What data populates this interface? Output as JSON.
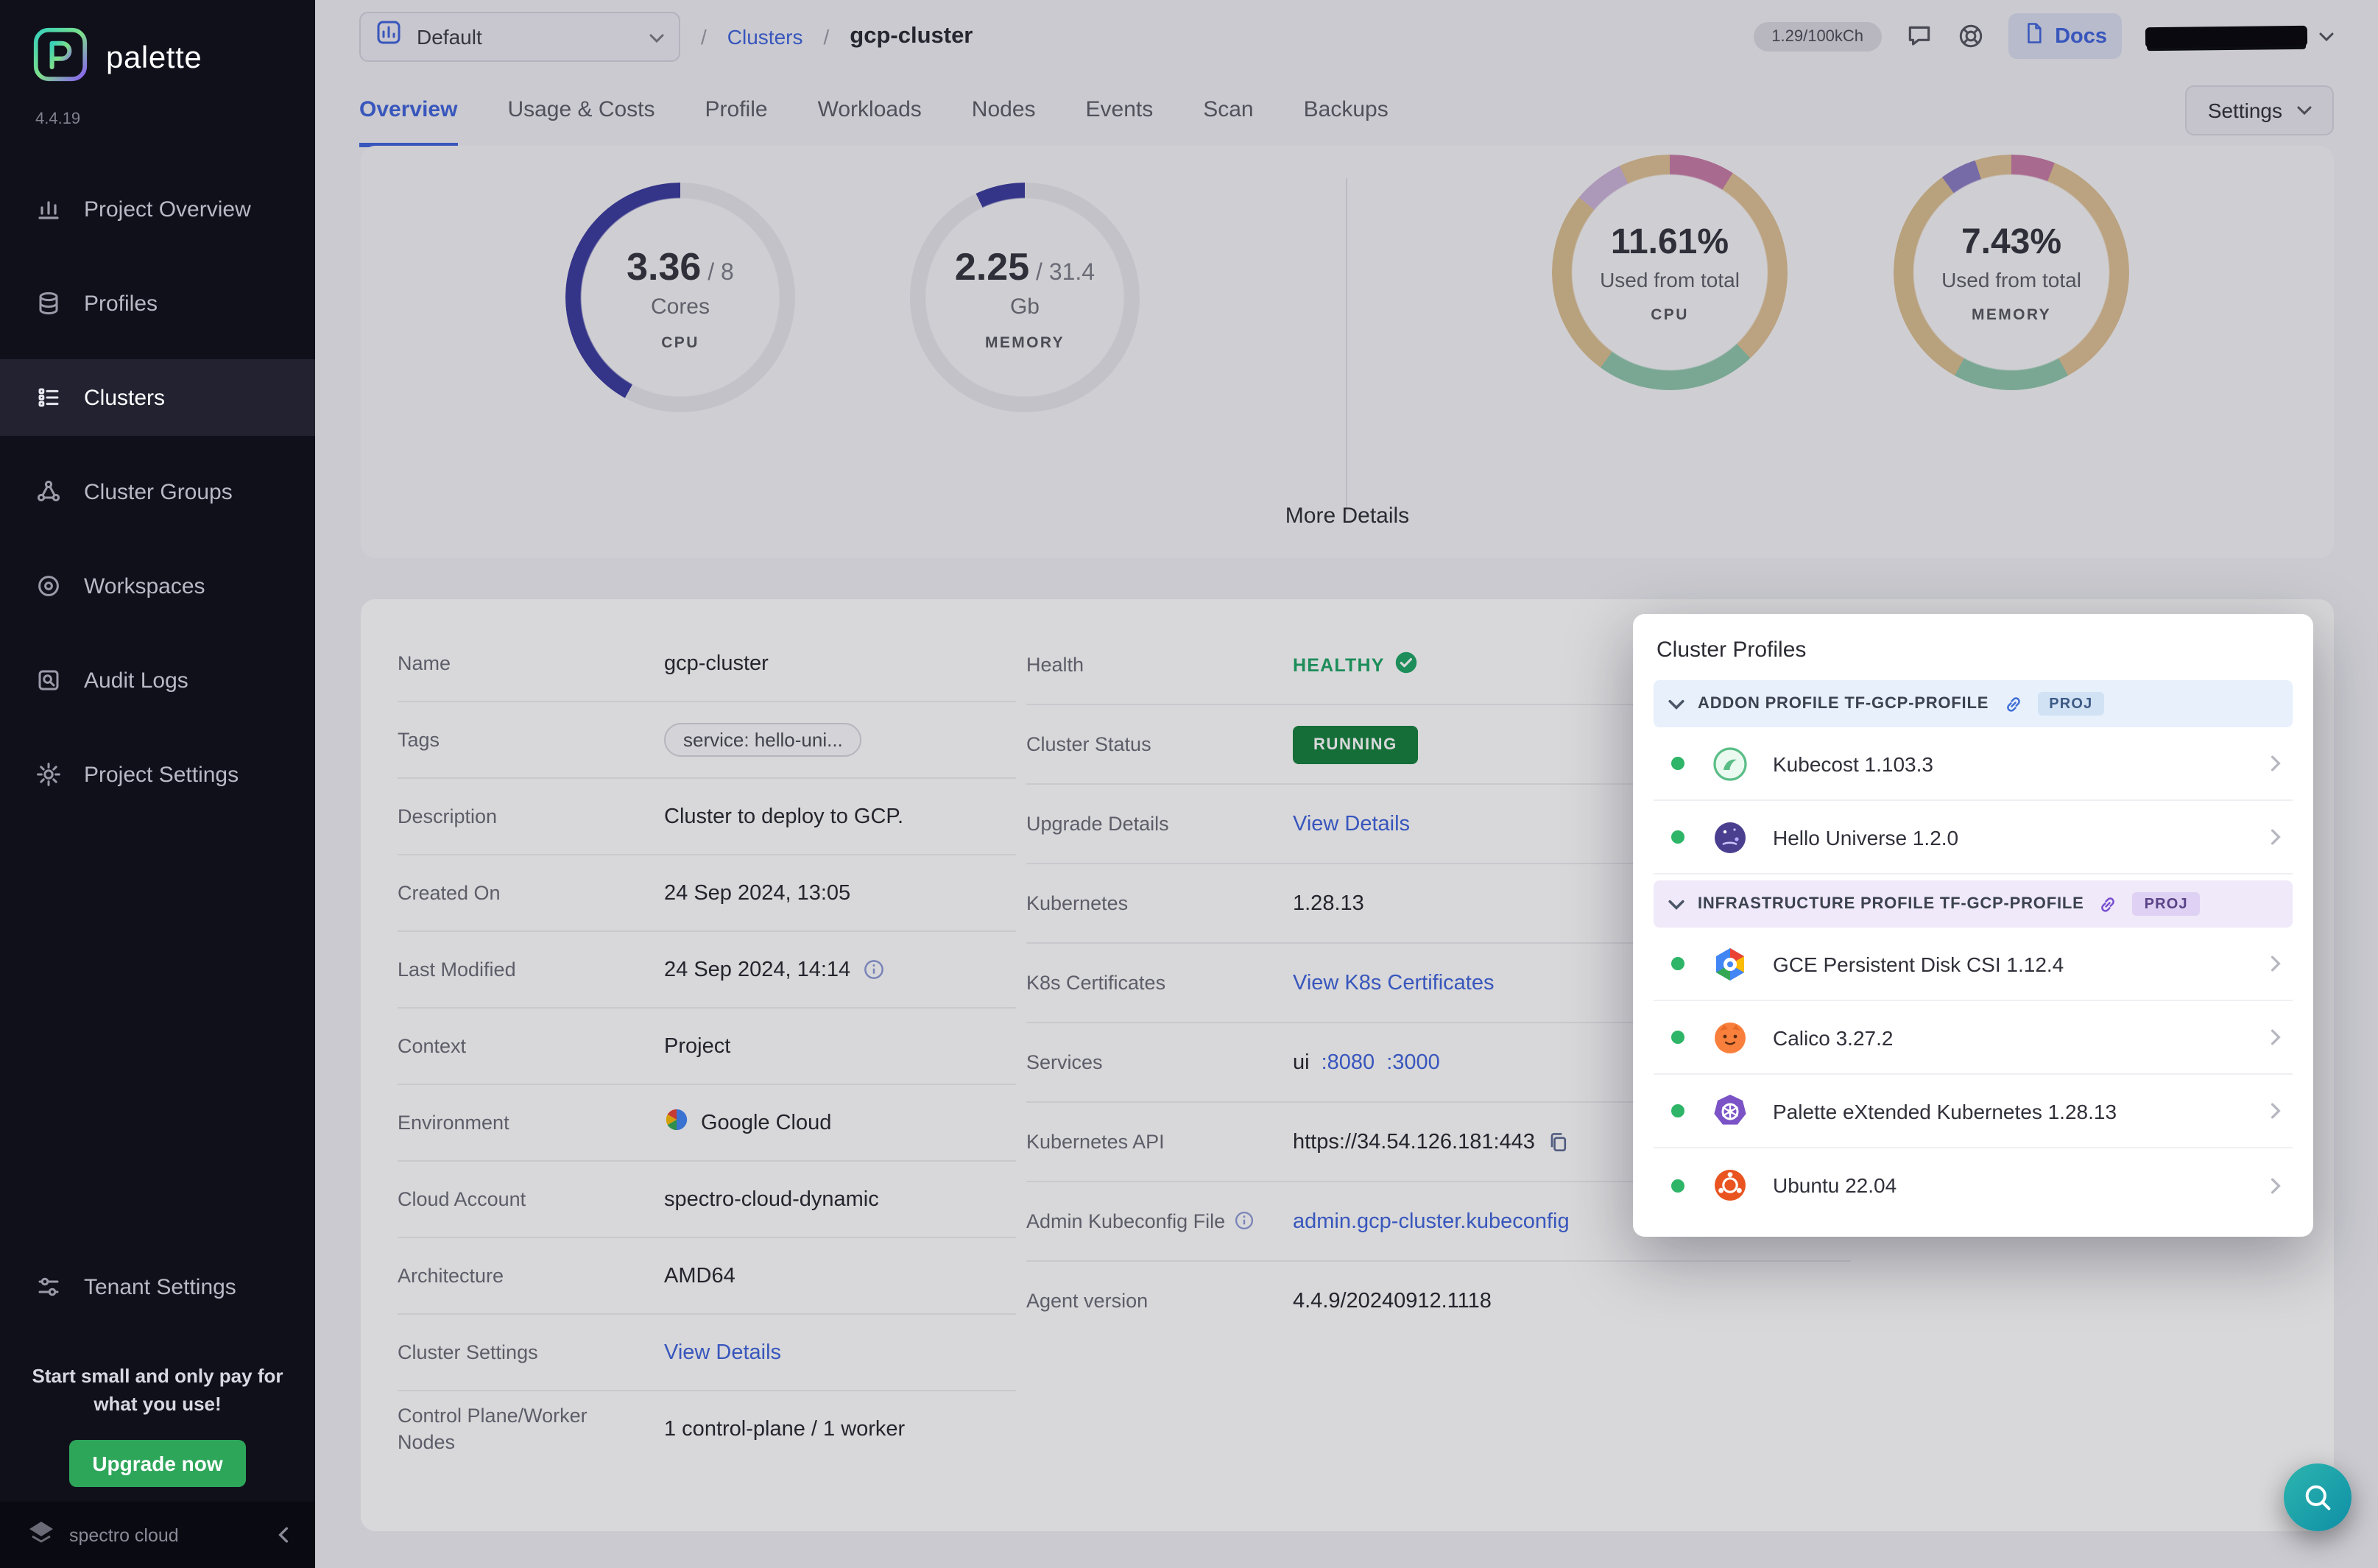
{
  "colors": {
    "accent": "#3f63db",
    "success": "#1fa566",
    "status_badge": "#15803d",
    "gauge": "#3a3a9e",
    "fab": "#16a3a3",
    "sidebar_bg": "#10101b",
    "upgrade_green": "#2ea65a"
  },
  "sidebar": {
    "brand": "palette",
    "version": "4.4.19",
    "items": [
      {
        "label": "Project Overview"
      },
      {
        "label": "Profiles"
      },
      {
        "label": "Clusters"
      },
      {
        "label": "Cluster Groups"
      },
      {
        "label": "Workspaces"
      },
      {
        "label": "Audit Logs"
      },
      {
        "label": "Project Settings"
      }
    ],
    "tenant": "Tenant Settings",
    "promo": "Start small and only pay for what you use!",
    "upgrade": "Upgrade now",
    "footer": "spectro cloud"
  },
  "topbar": {
    "project": "Default",
    "sep": "/",
    "breadcrumb_root": "Clusters",
    "breadcrumb_current": "gcp-cluster",
    "usage": "1.29/100kCh",
    "docs": "Docs"
  },
  "tabs": {
    "items": [
      "Overview",
      "Usage & Costs",
      "Profile",
      "Workloads",
      "Nodes",
      "Events",
      "Scan",
      "Backups"
    ],
    "settings": "Settings"
  },
  "stats": {
    "cpu": {
      "used": "3.36",
      "total": "/ 8",
      "unit": "Cores",
      "label": "CPU",
      "percent": 42
    },
    "memory": {
      "used": "2.25",
      "total": "/ 31.4",
      "unit": "Gb",
      "label": "MEMORY",
      "percent": 7
    },
    "cpu_total": {
      "value": "11.61%",
      "caption": "Used from total",
      "label": "CPU"
    },
    "memory_total": {
      "value": "7.43%",
      "caption": "Used from total",
      "label": "MEMORY"
    },
    "more": "More Details"
  },
  "details": {
    "name_label": "Name",
    "name": "gcp-cluster",
    "tags_label": "Tags",
    "tags": "service: hello-uni...",
    "desc_label": "Description",
    "desc": "Cluster to deploy to GCP.",
    "created_label": "Created On",
    "created": "24 Sep 2024, 13:05",
    "modified_label": "Last Modified",
    "modified": "24 Sep 2024, 14:14",
    "context_label": "Context",
    "context": "Project",
    "env_label": "Environment",
    "env": "Google Cloud",
    "account_label": "Cloud Account",
    "account": "spectro-cloud-dynamic",
    "arch_label": "Architecture",
    "arch": "AMD64",
    "settings_label": "Cluster Settings",
    "settings": "View Details",
    "nodes_label": "Control Plane/Worker Nodes",
    "nodes": "1 control-plane / 1 worker",
    "health_label": "Health",
    "health": "HEALTHY",
    "status_label": "Cluster Status",
    "status": "RUNNING",
    "upgrade_label": "Upgrade Details",
    "upgrade": "View Details",
    "k8s_label": "Kubernetes",
    "k8s": "1.28.13",
    "cert_label": "K8s Certificates",
    "cert": "View K8s Certificates",
    "services_label": "Services",
    "services_name": "ui",
    "services_port1": ":8080",
    "services_port2": ":3000",
    "api_label": "Kubernetes API",
    "api": "https://34.54.126.181:443",
    "kubeconfig_label": "Admin Kubeconfig File",
    "kubeconfig": "admin.gcp-cluster.kubeconfig",
    "agent_label": "Agent version",
    "agent": "4.4.9/20240912.1118"
  },
  "profiles_panel": {
    "title": "Cluster Profiles",
    "addon": {
      "name": "ADDON PROFILE TF-GCP-PROFILE",
      "badge": "PROJ",
      "items": [
        {
          "name": "Kubecost 1.103.3"
        },
        {
          "name": "Hello Universe 1.2.0"
        }
      ]
    },
    "infra": {
      "name": "INFRASTRUCTURE PROFILE TF-GCP-PROFILE",
      "badge": "PROJ",
      "items": [
        {
          "name": "GCE Persistent Disk CSI 1.12.4"
        },
        {
          "name": "Calico 3.27.2"
        },
        {
          "name": "Palette eXtended Kubernetes 1.28.13"
        },
        {
          "name": "Ubuntu 22.04"
        }
      ]
    }
  }
}
